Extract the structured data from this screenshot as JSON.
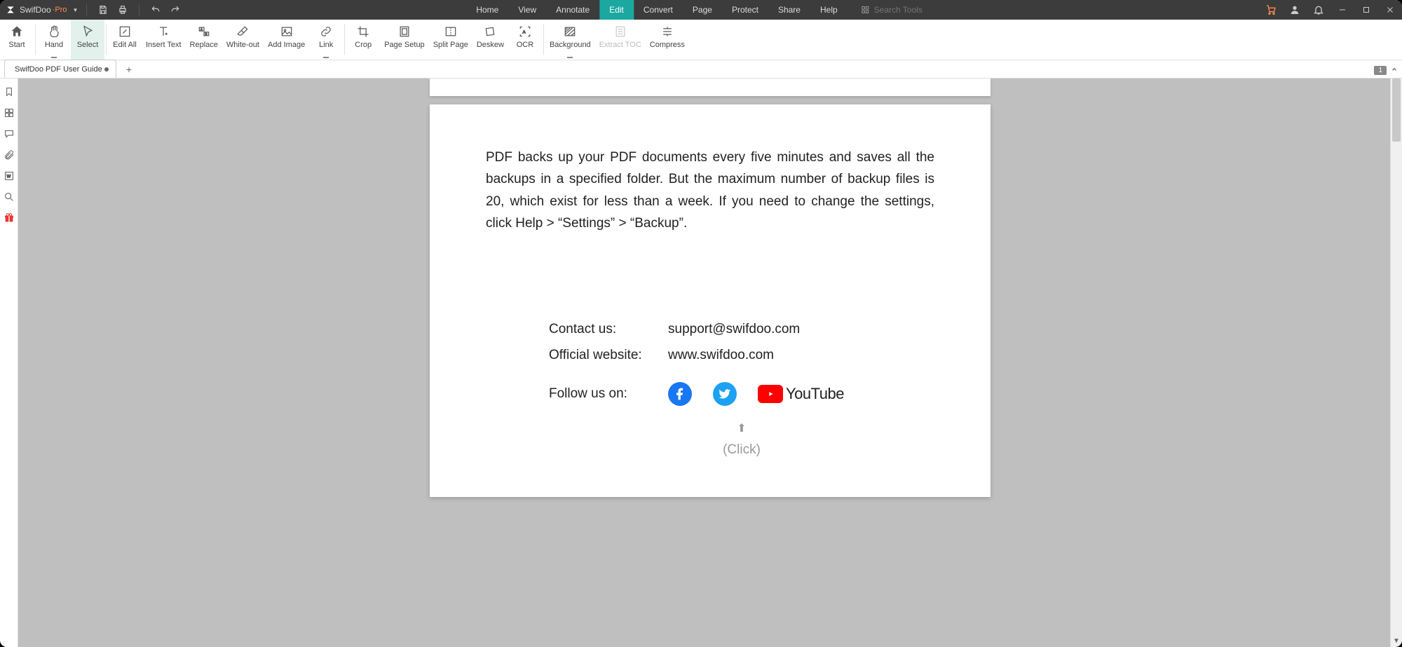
{
  "titlebar": {
    "app_name": "SwifDoo",
    "edition": "·Pro",
    "search_placeholder": "Search Tools"
  },
  "menu": [
    {
      "label": "Home",
      "active": false
    },
    {
      "label": "View",
      "active": false
    },
    {
      "label": "Annotate",
      "active": false
    },
    {
      "label": "Edit",
      "active": true
    },
    {
      "label": "Convert",
      "active": false
    },
    {
      "label": "Page",
      "active": false
    },
    {
      "label": "Protect",
      "active": false
    },
    {
      "label": "Share",
      "active": false
    },
    {
      "label": "Help",
      "active": false
    }
  ],
  "ribbon": [
    {
      "label": "Start",
      "icon": "home",
      "active": false
    },
    {
      "label": "Hand",
      "icon": "hand",
      "active": false,
      "dropdown": true
    },
    {
      "label": "Select",
      "icon": "cursor",
      "active": true
    },
    {
      "label": "Edit All",
      "icon": "edit",
      "active": false
    },
    {
      "label": "Insert Text",
      "icon": "insert-text",
      "active": false
    },
    {
      "label": "Replace",
      "icon": "replace",
      "active": false
    },
    {
      "label": "White-out",
      "icon": "eraser",
      "active": false
    },
    {
      "label": "Add Image",
      "icon": "image",
      "active": false
    },
    {
      "label": "Link",
      "icon": "link",
      "active": false,
      "dropdown": true
    },
    {
      "label": "Crop",
      "icon": "crop",
      "active": false
    },
    {
      "label": "Page Setup",
      "icon": "page-setup",
      "active": false
    },
    {
      "label": "Split Page",
      "icon": "split",
      "active": false
    },
    {
      "label": "Deskew",
      "icon": "deskew",
      "active": false
    },
    {
      "label": "OCR",
      "icon": "ocr",
      "active": false
    },
    {
      "label": "Background",
      "icon": "background",
      "active": false,
      "dropdown": true
    },
    {
      "label": "Extract TOC",
      "icon": "toc",
      "disabled": true
    },
    {
      "label": "Compress",
      "icon": "compress",
      "active": false
    }
  ],
  "tabs": {
    "document_title": "SwifDoo PDF User Guide",
    "page_indicator": "1"
  },
  "document": {
    "paragraph": "PDF backs up your PDF documents every five minutes and saves all the backups in a specified folder. But the maximum number of backup files is 20, which exist for less than a week. If you need to change the settings, click Help > “Settings” > “Backup”.",
    "contact_label": "Contact us:",
    "contact_value": "support@swifdoo.com",
    "website_label": "Official website:",
    "website_value": "www.swifdoo.com",
    "follow_label": "Follow us on:",
    "youtube_label": "YouTube",
    "click_hint": "(Click)"
  }
}
